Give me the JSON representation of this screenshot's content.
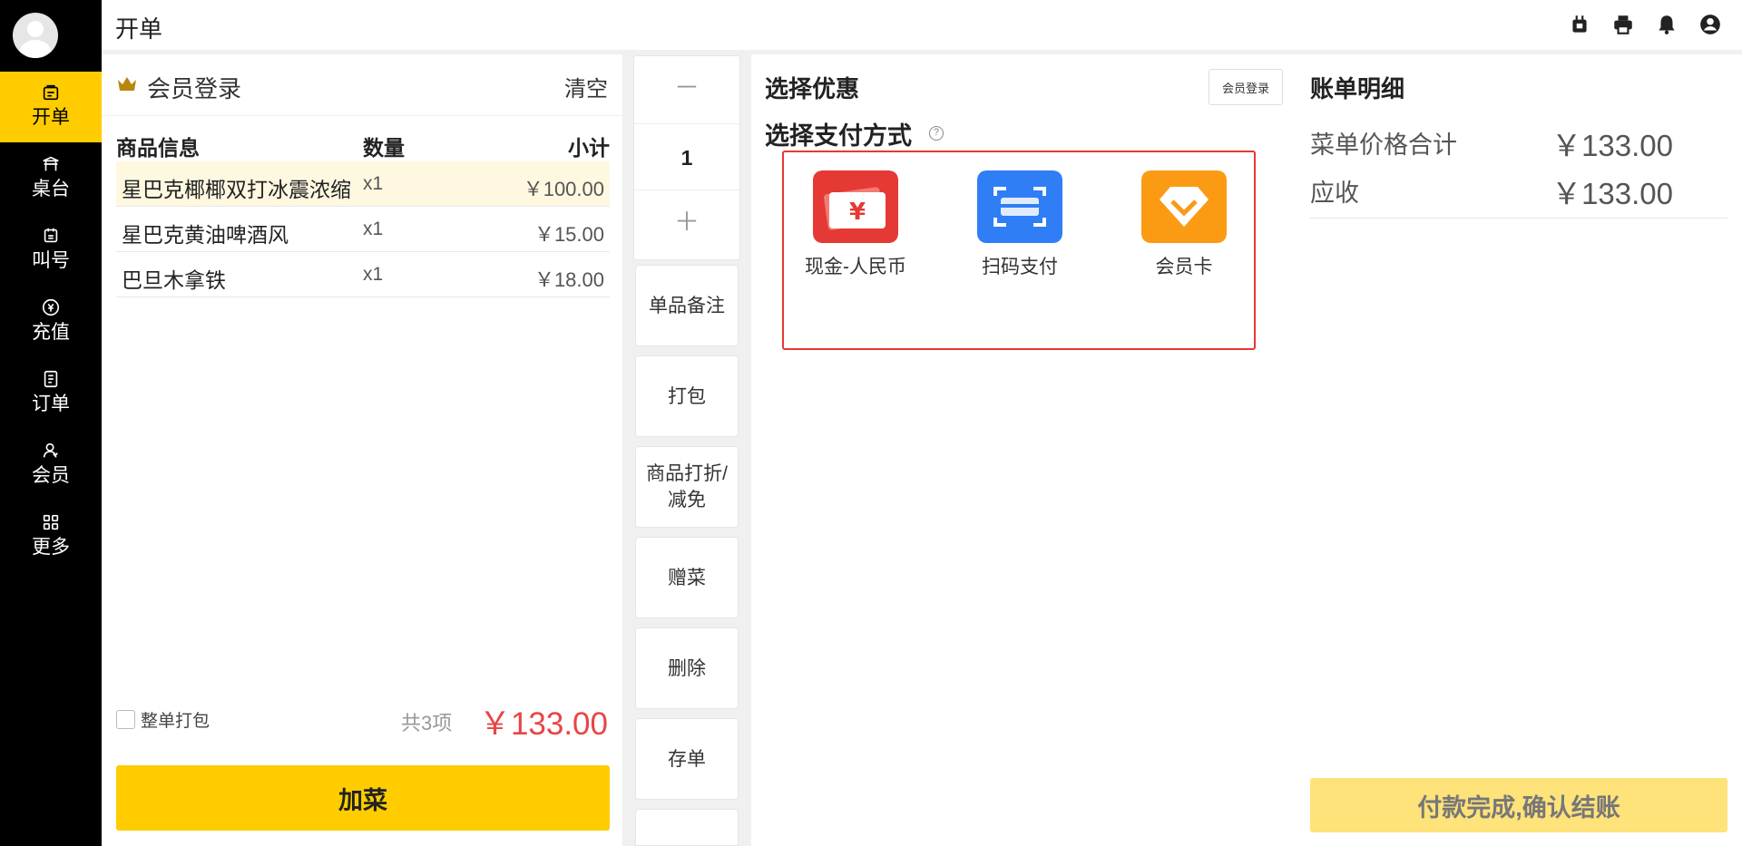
{
  "header": {
    "title": "开单"
  },
  "header_icons": [
    "bell-alarm-icon",
    "printer-icon",
    "notification-bell-icon",
    "user-account-icon"
  ],
  "sidebar": {
    "items": [
      {
        "label": "开单",
        "icon": "order-icon",
        "active": true
      },
      {
        "label": "桌台",
        "icon": "table-icon"
      },
      {
        "label": "叫号",
        "icon": "call-number-icon"
      },
      {
        "label": "充值",
        "icon": "recharge-icon"
      },
      {
        "label": "订单",
        "icon": "orders-icon"
      },
      {
        "label": "会员",
        "icon": "member-icon"
      },
      {
        "label": "更多",
        "icon": "more-icon"
      }
    ]
  },
  "order": {
    "member_login": "会员登录",
    "clear": "清空",
    "columns": {
      "name": "商品信息",
      "qty": "数量",
      "subtotal": "小计"
    },
    "items": [
      {
        "name": "星巴克椰椰双打冰震浓缩",
        "qty": "x1",
        "price": "￥100.00",
        "selected": true
      },
      {
        "name": "星巴克黄油啤酒风",
        "qty": "x1",
        "price": "￥15.00"
      },
      {
        "name": "巴旦木拿铁",
        "qty": "x1",
        "price": "￥18.00"
      }
    ],
    "pack_all": "整单打包",
    "count": "共3项",
    "total": "￥133.00",
    "add_button": "加菜"
  },
  "actions": {
    "minus": "－",
    "quantity": "1",
    "plus": "＋",
    "buttons": [
      "单品备注",
      "打包",
      "商品打折/减免",
      "赠菜",
      "删除",
      "存单"
    ]
  },
  "payment": {
    "discount_title": "选择优惠",
    "member_login_button": "会员登录",
    "method_title": "选择支付方式",
    "help": "?",
    "methods": [
      {
        "label": "现金-人民币",
        "icon": "cash-rmb-icon",
        "color": "#e53935"
      },
      {
        "label": "扫码支付",
        "icon": "scan-pay-icon",
        "color": "#2f7ef5"
      },
      {
        "label": "会员卡",
        "icon": "member-card-icon",
        "color": "#fb9b14"
      }
    ]
  },
  "bill": {
    "title": "账单明细",
    "rows": [
      {
        "label": "菜单价格合计",
        "value": "￥133.00"
      },
      {
        "label": "应收",
        "value": "￥133.00"
      }
    ],
    "confirm_button": "付款完成,确认结账"
  },
  "colors": {
    "accent": "#ffcc00",
    "total": "#e84545",
    "highlight": "#e53935"
  }
}
